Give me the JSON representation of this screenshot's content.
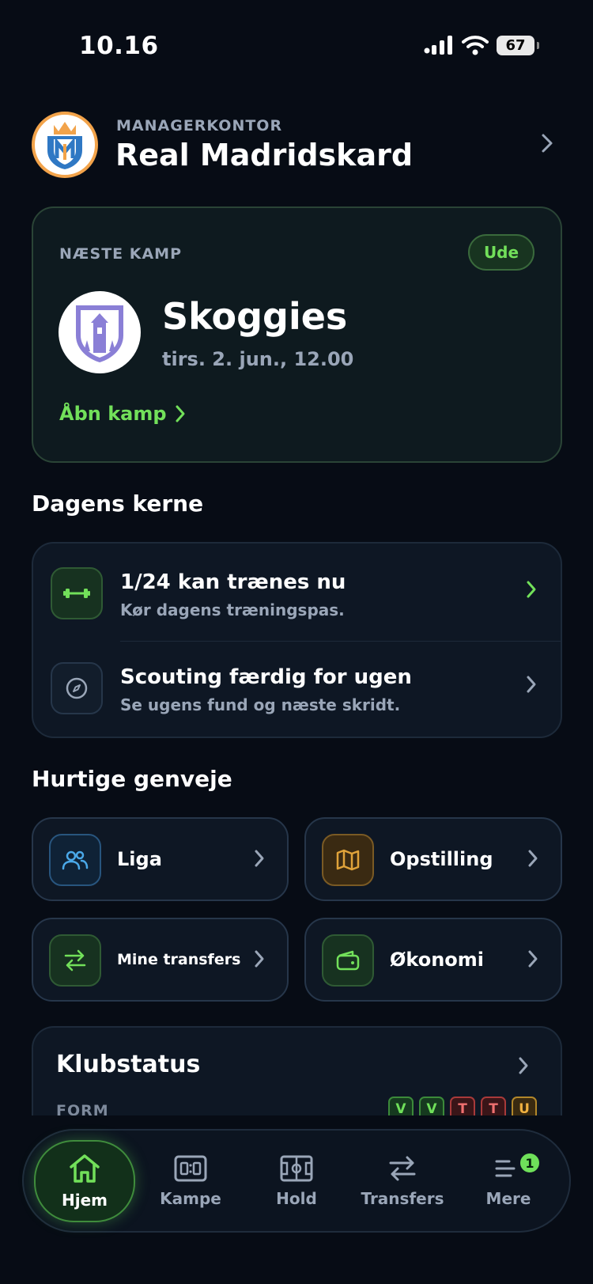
{
  "status_bar": {
    "time": "10.16",
    "battery": "67"
  },
  "header": {
    "kicker": "MANAGERKONTOR",
    "club_name": "Real Madridskard"
  },
  "next_match": {
    "kicker": "NÆSTE KAMP",
    "venue_badge": "Ude",
    "opponent": "Skoggies",
    "datetime": "tirs. 2. jun., 12.00",
    "open_link": "Åbn kamp"
  },
  "todays_core": {
    "title": "Dagens kerne",
    "items": [
      {
        "title": "1/24 kan trænes nu",
        "subtitle": "Kør dagens træningspas.",
        "icon": "dumbbell-icon"
      },
      {
        "title": "Scouting færdig for ugen",
        "subtitle": "Se ugens fund og næste skridt.",
        "icon": "compass-icon"
      }
    ]
  },
  "shortcuts": {
    "title": "Hurtige genveje",
    "items": [
      {
        "label": "Liga",
        "icon": "users-icon",
        "color": "#4aa8e8"
      },
      {
        "label": "Opstilling",
        "icon": "map-icon",
        "color": "#e0a33a"
      },
      {
        "label": "Mine transfers",
        "icon": "transfer-icon",
        "color": "#6fe05a"
      },
      {
        "label": "Økonomi",
        "icon": "wallet-icon",
        "color": "#6fe05a"
      }
    ]
  },
  "club_status": {
    "title": "Klubstatus",
    "form_label": "FORM",
    "form": [
      "V",
      "V",
      "T",
      "T",
      "U"
    ]
  },
  "tabbar": {
    "items": [
      {
        "label": "Hjem",
        "icon": "home-icon",
        "active": true
      },
      {
        "label": "Kampe",
        "icon": "scoreboard-icon"
      },
      {
        "label": "Hold",
        "icon": "pitch-icon"
      },
      {
        "label": "Transfers",
        "icon": "transfer-icon"
      },
      {
        "label": "Mere",
        "icon": "menu-icon",
        "badge": "1"
      }
    ]
  },
  "colors": {
    "accent": "#72e05a",
    "background": "#070c15",
    "card": "#0e1724"
  }
}
